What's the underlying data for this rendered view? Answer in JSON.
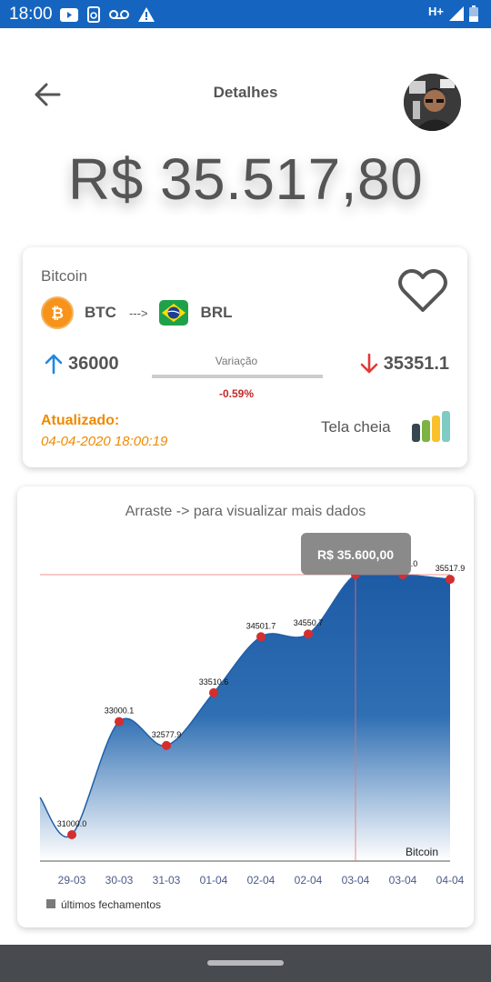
{
  "status_bar": {
    "time": "18:00",
    "network": "H+"
  },
  "header": {
    "title": "Detalhes"
  },
  "price": "R$ 35.517,80",
  "card": {
    "coin_name": "Bitcoin",
    "from": "BTC",
    "arrow": "--->",
    "to": "BRL",
    "high": "36000",
    "low": "35351.1",
    "variation_label": "Variação",
    "variation_value": "-0.59%",
    "updated_label": "Atualizado:",
    "updated_time": "04-04-2020 18:00:19",
    "fullscreen_label": "Tela cheia"
  },
  "chart_data": {
    "type": "area",
    "title": "Arraste -> para visualizar mais dados",
    "categories": [
      "29-03",
      "30-03",
      "31-03",
      "01-04",
      "02-04",
      "02-04",
      "03-04",
      "03-04",
      "04-04"
    ],
    "series": [
      {
        "name": "Bitcoin",
        "values": [
          31000.0,
          33000.1,
          32577.9,
          33510.6,
          34501.7,
          34550.7,
          35600.0,
          35600.0,
          35517.9
        ]
      }
    ],
    "data_labels": [
      "31000.0",
      "33000.1",
      "32577.9",
      "33510.6",
      "34501.7",
      "34550.7",
      "35600.0",
      "35600.0",
      "35517.9"
    ],
    "tooltip": "R$ 35.600,00",
    "legend": "últimos fechamentos",
    "colors": {
      "area": "#1f5fa8",
      "point": "#d32f2f",
      "guide": "#e57373"
    }
  }
}
